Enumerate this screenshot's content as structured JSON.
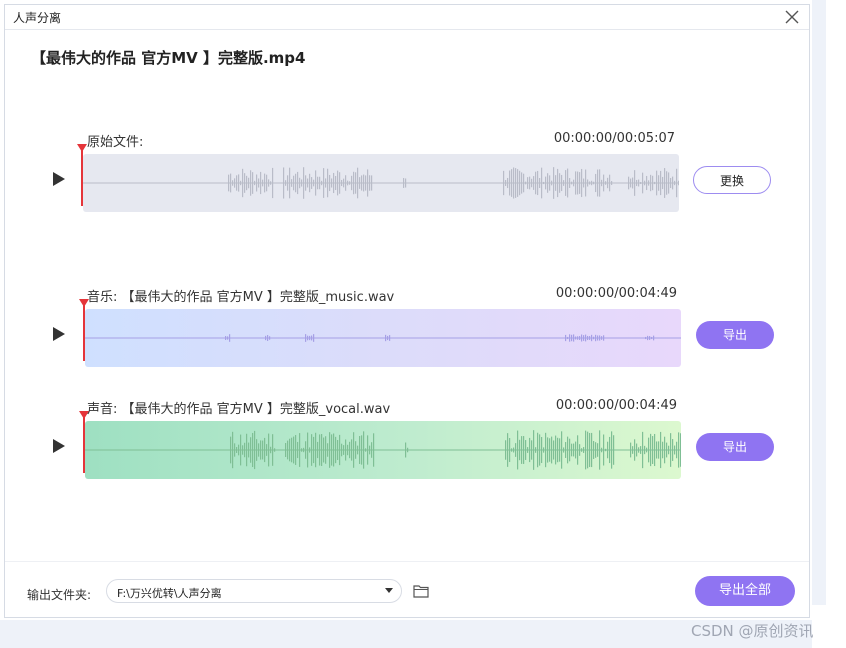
{
  "window": {
    "title": "人声分离"
  },
  "file_title": "【最伟大的作品  官方MV 】完整版.mp4",
  "tracks": {
    "original": {
      "label": "原始文件:",
      "time": "00:00:00/00:05:07",
      "button": "更换"
    },
    "music": {
      "label": "音乐:  【最伟大的作品  官方MV 】完整版_music.wav",
      "time": "00:00:00/00:04:49",
      "button": "导出"
    },
    "vocal": {
      "label": "声音:  【最伟大的作品  官方MV 】完整版_vocal.wav",
      "time": "00:00:00/00:04:49",
      "button": "导出"
    }
  },
  "footer": {
    "output_label": "输出文件夹:",
    "path": "F:\\万兴优转\\人声分离",
    "export_all": "导出全部"
  },
  "watermark": "CSDN @原创资讯",
  "colors": {
    "accent": "#8f74f2",
    "playhead": "#e5353a"
  },
  "icons": {
    "close": "close-icon",
    "play": "play-icon",
    "folder": "folder-icon",
    "dropdown": "chevron-down-icon"
  }
}
